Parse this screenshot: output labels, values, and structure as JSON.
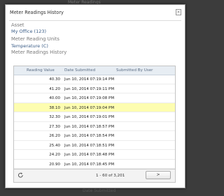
{
  "background": {
    "top_text": "Meter Readings",
    "bottom_text": "Date Submitted"
  },
  "dialog": {
    "title": "Meter Readings History",
    "close_icon": "×"
  },
  "details": {
    "asset_label": "Asset",
    "asset_value": "My Office (123)",
    "units_label": "Meter Reading Units",
    "units_value": "Temperature (C)",
    "history_label": "Meter Readings History"
  },
  "grid": {
    "columns": [
      "Reading Value",
      "Date Submitted",
      "Submitted By User"
    ],
    "rows": [
      {
        "value": "40.30",
        "date": "Jun 10, 2014 07:19:14 PM",
        "user": "",
        "highlight": false
      },
      {
        "value": "41.20",
        "date": "Jun 10, 2014 07:19:11 PM",
        "user": "",
        "highlight": false
      },
      {
        "value": "40.00",
        "date": "Jun 10, 2014 07:19:08 PM",
        "user": "",
        "highlight": false
      },
      {
        "value": "38.10",
        "date": "Jun 10, 2014 07:19:04 PM",
        "user": "",
        "highlight": true
      },
      {
        "value": "32.30",
        "date": "Jun 10, 2014 07:19:01 PM",
        "user": "",
        "highlight": false
      },
      {
        "value": "27.30",
        "date": "Jun 10, 2014 07:18:57 PM",
        "user": "",
        "highlight": false
      },
      {
        "value": "26.20",
        "date": "Jun 10, 2014 07:18:54 PM",
        "user": "",
        "highlight": false
      },
      {
        "value": "25.40",
        "date": "Jun 10, 2014 07:18:51 PM",
        "user": "",
        "highlight": false
      },
      {
        "value": "24.20",
        "date": "Jun 10, 2014 07:18:48 PM",
        "user": "",
        "highlight": false
      },
      {
        "value": "20.90",
        "date": "Jun 10, 2014 07:18:45 PM",
        "user": "",
        "highlight": false
      }
    ]
  },
  "footer": {
    "refresh_icon": "refresh-icon",
    "pager_text": "1 - 60 of 3,201",
    "next_label": ">"
  },
  "colors": {
    "highlight": "#fdfdb0",
    "header_bg": "#e7edf3",
    "value_text": "#3a5c86"
  }
}
